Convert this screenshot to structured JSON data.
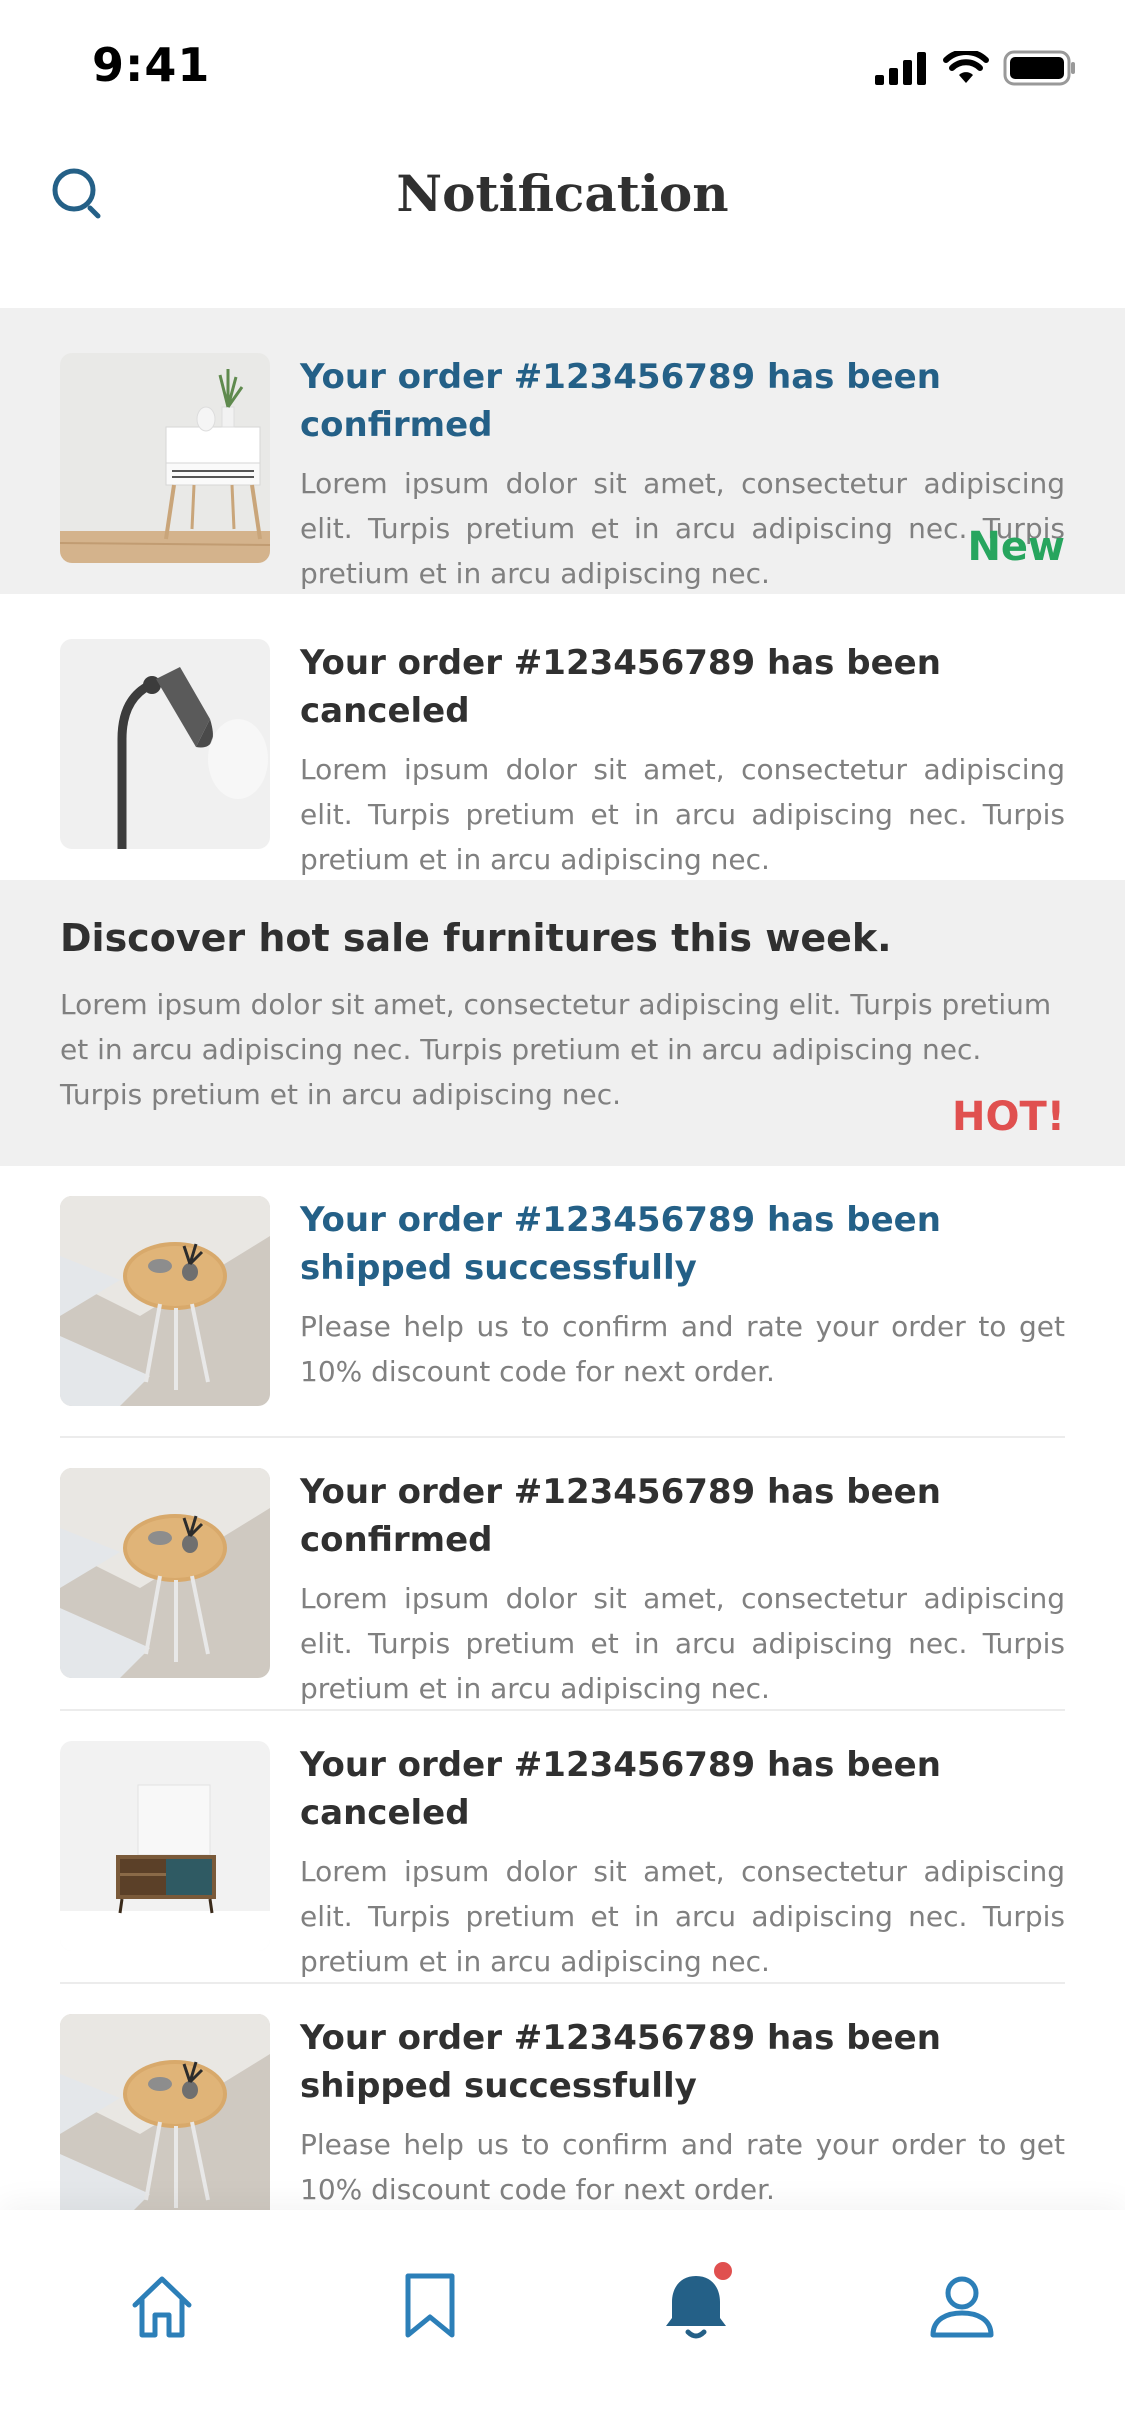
{
  "status_bar": {
    "time": "9:41"
  },
  "header": {
    "title": "Notification"
  },
  "colors": {
    "accent": "#246087",
    "new": "#27a55e",
    "hot": "#e0504f",
    "highlight_bg": "#f0f0f0"
  },
  "notifications": [
    {
      "title": "Your order #123456789 has been confirmed",
      "body": "Lorem ipsum dolor sit amet, consectetur adipiscing elit. Turpis pretium et in arcu adipiscing nec. Turpis pretium et in arcu adipiscing nec.",
      "tag": "New",
      "image": "nightstand-with-plant"
    },
    {
      "title": "Your order #123456789 has been canceled",
      "body": "Lorem ipsum dolor sit amet, consectetur adipiscing elit. Turpis pretium et in arcu adipiscing nec. Turpis pretium et in arcu adipiscing nec.",
      "image": "floor-lamp"
    },
    {
      "title": "Discover hot sale furnitures this week.",
      "body": "Lorem ipsum dolor sit amet, consectetur adipiscing elit. Turpis pretium et in arcu adipiscing nec. Turpis pretium et in arcu adipiscing nec. Turpis pretium et in arcu adipiscing nec.",
      "tag": "HOT!"
    },
    {
      "title": "Your order #123456789 has been shipped successfully",
      "body": "Please help us to confirm and rate your order to get 10% discount code for next order.",
      "image": "round-side-table"
    },
    {
      "title": "Your order #123456789 has been confirmed",
      "body": "Lorem ipsum dolor sit amet, consectetur adipiscing elit. Turpis pretium et in arcu adipiscing nec. Turpis pretium et in arcu adipiscing nec.",
      "image": "round-side-table"
    },
    {
      "title": "Your order #123456789 has been canceled",
      "body": "Lorem ipsum dolor sit amet, consectetur adipiscing elit. Turpis pretium et in arcu adipiscing nec. Turpis pretium et in arcu adipiscing nec.",
      "image": "sideboard-cabinet"
    },
    {
      "title": "Your order #123456789 has been shipped successfully",
      "body": "Please help us to confirm and rate your order to get 10% discount code for next order.",
      "image": "round-side-table"
    }
  ],
  "tabbar": {
    "items": [
      {
        "icon": "home-icon",
        "active": false
      },
      {
        "icon": "bookmark-icon",
        "active": false
      },
      {
        "icon": "bell-icon",
        "active": true,
        "has_badge": true
      },
      {
        "icon": "profile-icon",
        "active": false
      }
    ]
  }
}
